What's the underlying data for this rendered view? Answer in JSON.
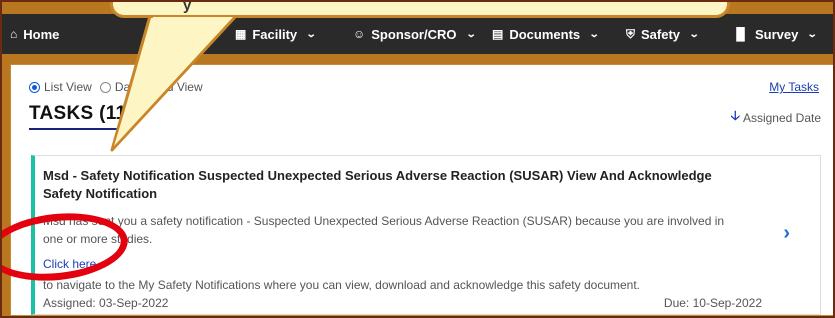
{
  "callout": {
    "text": "y"
  },
  "nav": {
    "items": [
      {
        "label": "Home",
        "icon": "home-icon"
      },
      {
        "label": "Facility",
        "icon": "building-icon"
      },
      {
        "label": "Sponsor/CRO",
        "icon": "users-icon"
      },
      {
        "label": "Documents",
        "icon": "document-icon"
      },
      {
        "label": "Safety",
        "icon": "shield-icon"
      },
      {
        "label": "Survey",
        "icon": "bar-chart-icon"
      }
    ]
  },
  "view": {
    "list_label": "List View",
    "dashboard_label": "Dashboard View",
    "selected": "List View"
  },
  "tasks": {
    "title": "TASKS (11)",
    "my_tasks_link": "My Tasks",
    "sort_label": "Assigned Date"
  },
  "task_card": {
    "title": "Msd - Safety Notification Suspected Unexpected Serious Adverse Reaction (SUSAR) View And Acknowledge Safety Notification",
    "description": "Msd has sent you a safety notification - Suspected Unexpected Serious Adverse Reaction (SUSAR) because you are involved in one or more studies.",
    "link_text": "Click here",
    "navigate_text": "to navigate to the My Safety Notifications where you can view, download and acknowledge this safety document.",
    "assigned": "Assigned: 03-Sep-2022",
    "due": "Due: 10-Sep-2022"
  },
  "colors": {
    "nav_bg": "#2a2a2a",
    "accent_teal": "#1cc1a4",
    "link_blue": "#1a3fb0",
    "annotation_red": "#e3000f",
    "frame_brown": "#b9771f"
  }
}
